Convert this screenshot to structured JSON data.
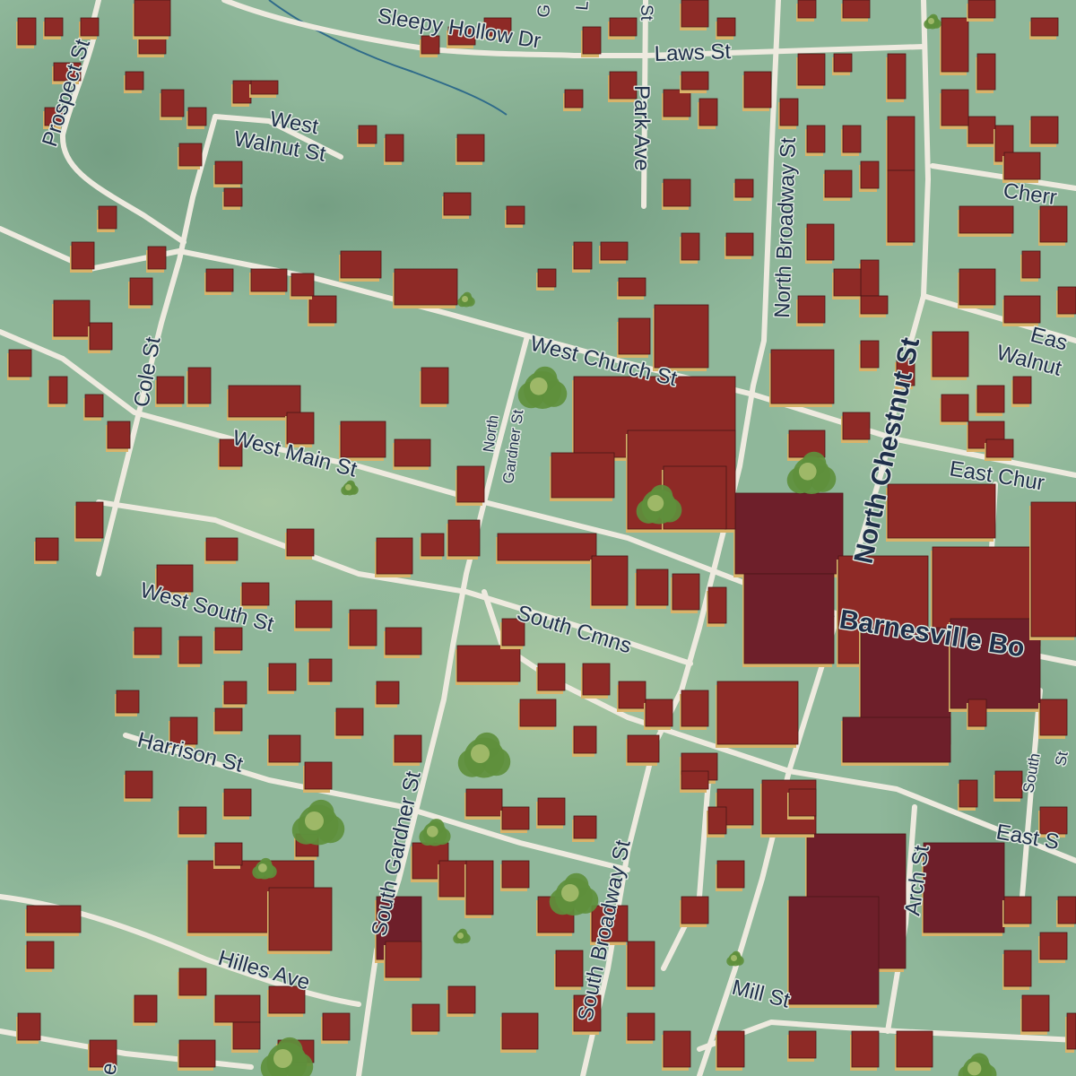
{
  "map": {
    "colors": {
      "ground": "#8fb79a",
      "road": "#eeeadf",
      "building": "#8e2a26",
      "building_dark": "#6e1f2a",
      "building_shadow": "#d9b36a",
      "tree": "#5e8f3c",
      "stream": "#2f6b8a",
      "label": "#1f2f4a"
    },
    "streets": {
      "sleepy_hollow_dr": "Sleepy Hollow Dr",
      "laws_st": "Laws St",
      "prospect_st": "Prospect St",
      "park_ave": "Park Ave",
      "north_broadway_st": "North Broadway St",
      "west_walnut_st_1": "West",
      "west_walnut_st_2": "Walnut St",
      "cherry_st": "Cherr",
      "north_chestnut_st": "North Chestnut St",
      "east_walnut_st_1": "Eas",
      "east_walnut_st_2": "Walnut",
      "cole_st": "Cole St",
      "west_church_st": "West Church St",
      "north_gardner_st_1": "North",
      "north_gardner_st_2": "Gardner St",
      "east_church_st": "East Chur",
      "west_main_st": "West Main St",
      "barnesville_bypass": "Barnesville Bo",
      "west_south_st": "West South St",
      "south_cmns": "South Cmns",
      "harrison_st": "Harrison St",
      "south_gardner_st": "South Gardner St",
      "south_broadway_st": "South Broadway St",
      "arch_st": "Arch St",
      "east_south_st": "East S",
      "south_st_1": "South",
      "south_st_2": "St",
      "hilles_ave": "Hilles Ave",
      "mill_st": "Mill St",
      "top_fragment_1": "G",
      "top_fragment_2": "L",
      "top_fragment_3": "St",
      "edge_fragment": "e"
    }
  }
}
